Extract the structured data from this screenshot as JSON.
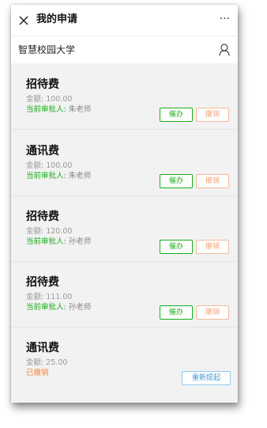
{
  "header": {
    "title": "我的申请",
    "more_label": "···"
  },
  "school": {
    "name": "智慧校园大学"
  },
  "applications": [
    {
      "title": "招待费",
      "amount": "金额: 100.00",
      "status_label": "当前审批人:",
      "approver": "朱老师",
      "urge_label": "催办",
      "revoke_label": "撤销"
    },
    {
      "title": "通讯费",
      "amount": "金额: 100.00",
      "status_label": "当前审批人:",
      "approver": "朱老师",
      "urge_label": "催办",
      "revoke_label": "撤销"
    },
    {
      "title": "招待费",
      "amount": "金额: 120.00",
      "status_label": "当前审批人:",
      "approver": "孙老师",
      "urge_label": "催办",
      "revoke_label": "撤销"
    },
    {
      "title": "招待费",
      "amount": "金额: 111.00",
      "status_label": "当前审批人:",
      "approver": "孙老师",
      "urge_label": "催办",
      "revoke_label": "撤销"
    },
    {
      "title": "通讯费",
      "amount": "金额: 25.00",
      "status_text": "已撤销",
      "resubmit_label": "重新提起"
    }
  ],
  "colors": {
    "approve_green": "#1aad19",
    "revoke_orange": "#f0883e",
    "resubmit_blue": "#3d9ad6"
  },
  "icons": [
    "close-icon",
    "more-icon",
    "user-icon"
  ]
}
